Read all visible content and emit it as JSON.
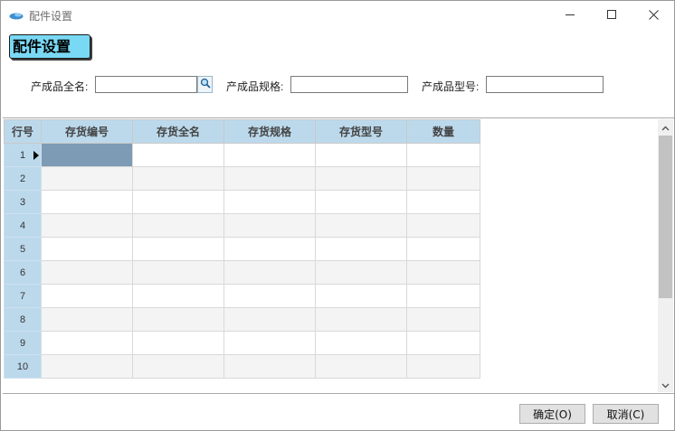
{
  "window": {
    "title": "配件设置",
    "controls": {
      "minimize": "minimize-icon",
      "maximize": "maximize-icon",
      "close": "close-icon"
    }
  },
  "heading": "配件设置",
  "filters": {
    "full_name_label": "产成品全名:",
    "full_name_value": "",
    "spec_label": "产成品规格:",
    "spec_value": "",
    "model_label": "产成品型号:",
    "model_value": ""
  },
  "grid": {
    "columns": [
      "行号",
      "存货编号",
      "存货全名",
      "存货规格",
      "存货型号",
      "数量"
    ],
    "rows": [
      "1",
      "2",
      "3",
      "4",
      "5",
      "6",
      "7",
      "8",
      "9",
      "10"
    ],
    "selected_row": "1"
  },
  "buttons": {
    "ok": "确定(O)",
    "cancel": "取消(C)"
  },
  "colors": {
    "header_bg": "#bcd9ec",
    "heading_bg": "#79d9f5",
    "selected_cell": "#7d9bb5"
  }
}
